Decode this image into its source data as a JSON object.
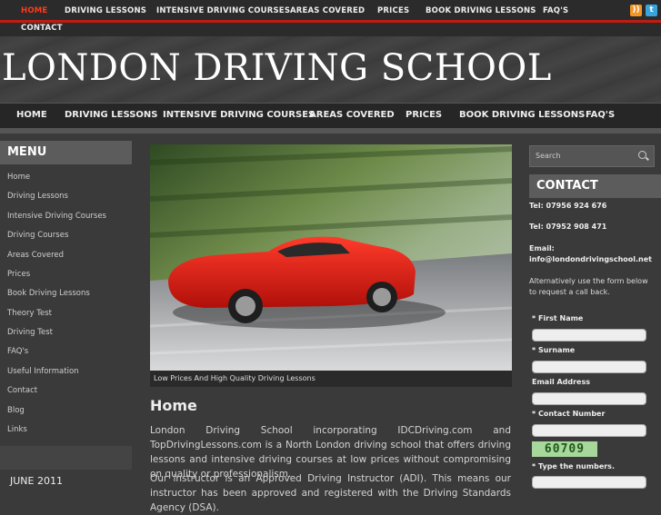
{
  "top_nav": {
    "items": [
      "HOME",
      "DRIVING LESSONS",
      "INTENSIVE DRIVING COURSES",
      "AREAS COVERED",
      "PRICES",
      "BOOK DRIVING LESSONS",
      "FAQ'S"
    ],
    "second_row": "CONTACT",
    "active": "HOME"
  },
  "social": {
    "rss": "rss-icon",
    "twitter": "twitter-icon"
  },
  "header": {
    "title": "LONDON DRIVING SCHOOL"
  },
  "main_nav": {
    "items": [
      "HOME",
      "DRIVING LESSONS",
      "INTENSIVE DRIVING COURSES",
      "AREAS COVERED",
      "PRICES",
      "BOOK DRIVING LESSONS",
      "FAQ'S"
    ]
  },
  "sidebar": {
    "heading": "MENU",
    "items": [
      "Home",
      "Driving Lessons",
      "Intensive Driving Courses",
      "Driving Courses",
      "Areas Covered",
      "Prices",
      "Book Driving Lessons",
      "Theory Test",
      "Driving Test",
      "FAQ's",
      "Useful Information",
      "Contact",
      "Blog",
      "Links"
    ],
    "archive_label": "JUNE 2011"
  },
  "main": {
    "image_caption": "Low Prices And High Quality Driving Lessons",
    "title": "Home",
    "paragraph1": "London Driving School incorporating IDCDriving.com and TopDrivingLessons.com is a North London driving school that offers driving lessons and intensive driving courses at low prices without compromising on quality or professionalism.",
    "paragraph2": "Our instructor is an Approved Driving Instructor (ADI). This means our instructor has been approved and registered with the Driving Standards Agency (DSA)."
  },
  "search": {
    "placeholder": "Search"
  },
  "contact": {
    "heading": "CONTACT",
    "tel1": "Tel: 07956 924 676",
    "tel2": "Tel: 07952 908 471",
    "email_label": "Email:",
    "email": "info@londondrivingschool.net",
    "note": "Alternatively use the form below to request a call back.",
    "form": {
      "first_name": "* First Name",
      "surname": "* Surname",
      "email": "Email Address",
      "contact_number": "* Contact Number",
      "captcha_code": "60709",
      "captcha_label": "* Type the numbers."
    }
  },
  "colors": {
    "accent": "#c01c10",
    "active_link": "#ff3a1c",
    "background": "#3a3a3a"
  }
}
